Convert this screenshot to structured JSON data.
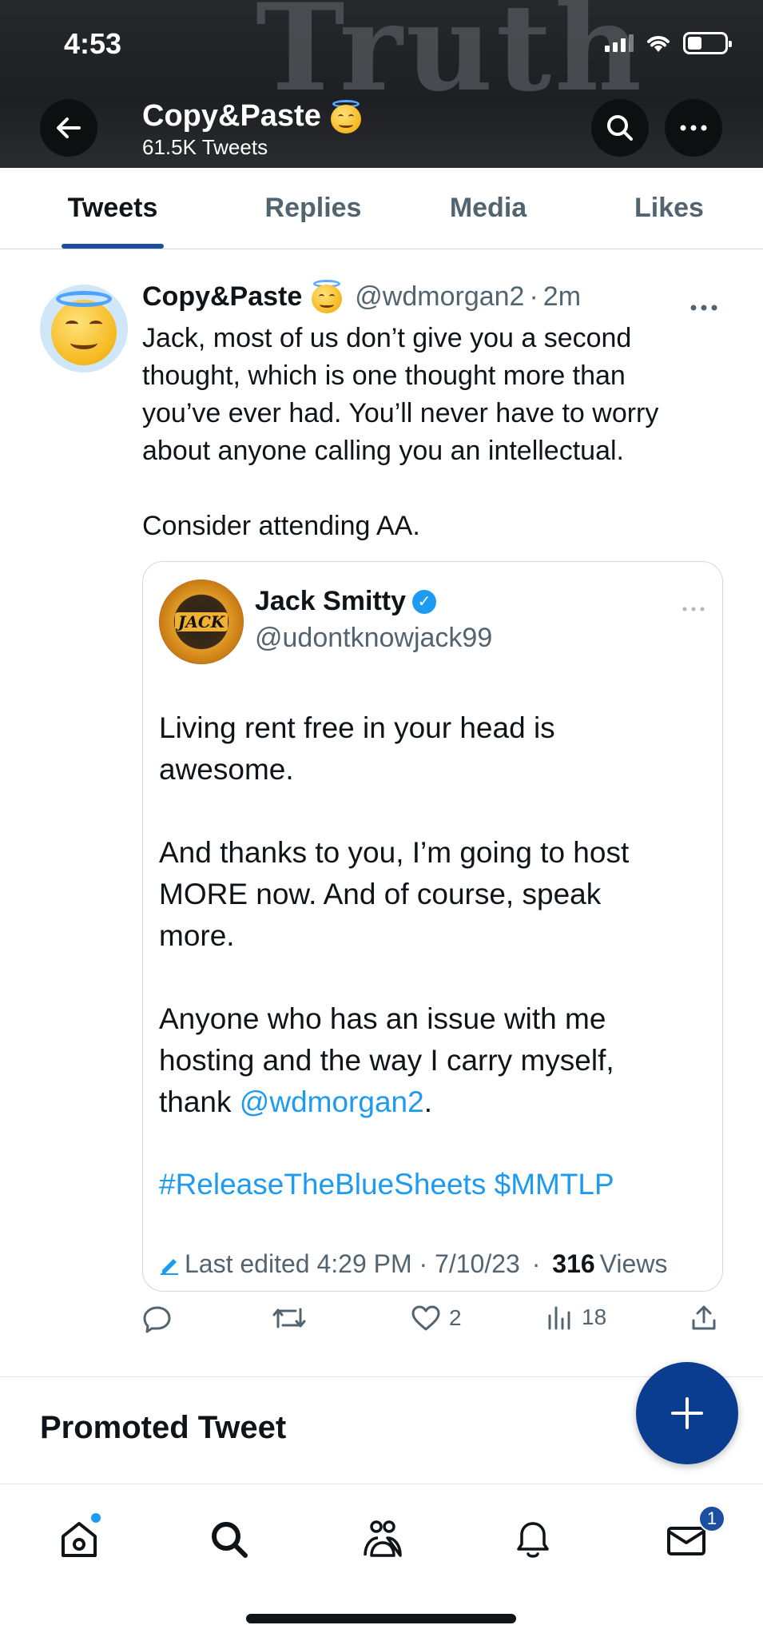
{
  "status_bar": {
    "time": "4:53"
  },
  "header": {
    "banner_text": "Truth",
    "profile_name": "Copy&Paste",
    "tweet_count": "61.5K Tweets"
  },
  "tabs": [
    {
      "label": "Tweets",
      "active": true
    },
    {
      "label": "Replies",
      "active": false
    },
    {
      "label": "Media",
      "active": false
    },
    {
      "label": "Likes",
      "active": false
    }
  ],
  "tweet": {
    "author_name": "Copy&Paste",
    "handle": "@wdmorgan2",
    "dot": "·",
    "time": "2m",
    "text": "Jack, most of us don’t give you a second\nthought, which is one thought more than\nyou’ve ever had. You’ll never have to worry\nabout anyone calling you an intellectual.\n\nConsider attending AA.",
    "quote": {
      "author_name": "Jack Smitty",
      "handle": "@udontknowjack99",
      "avatar_text": "JACK",
      "text_part1": "Living rent free in your head is\nawesome.\n\nAnd thanks to you, I’m going to host\nMORE now. And of course, speak\nmore.\n\nAnyone who has an issue with me\nhosting and the way I carry myself,\nthank ",
      "mention": "@wdmorgan2",
      "text_end": ".",
      "hashtags": "#ReleaseTheBlueSheets $MMTLP",
      "edited_label": "Last edited 4:29 PM · 7/10/23",
      "views_sep": " · ",
      "views_count": "316",
      "views_label": "Views"
    },
    "actions": {
      "likes": "2",
      "views": "18"
    }
  },
  "promoted_label": "Promoted Tweet",
  "bottom_nav": {
    "messages_badge": "1"
  },
  "colors": {
    "accent": "#1d9bf0",
    "fab": "#0a3d8f",
    "tab_indicator": "#1d4fa0"
  }
}
